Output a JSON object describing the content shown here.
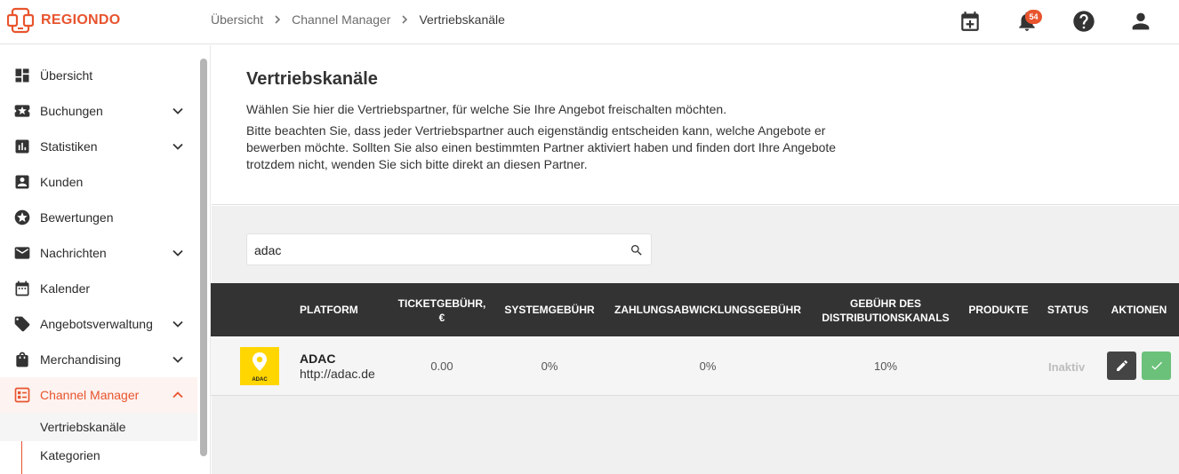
{
  "app": {
    "logo_text": "REGIONDO",
    "brand_color": "#e8542e"
  },
  "breadcrumb": [
    "Übersicht",
    "Channel Manager",
    "Vertriebskanäle"
  ],
  "topbar": {
    "notifications_count": "54",
    "icons": [
      "calendar-plus-icon",
      "bell-icon",
      "help-icon",
      "account-icon"
    ]
  },
  "sidebar": {
    "items": [
      {
        "label": "Übersicht",
        "icon": "dashboard-icon"
      },
      {
        "label": "Buchungen",
        "icon": "ticket-star-icon"
      },
      {
        "label": "Statistiken",
        "icon": "bar-chart-icon"
      },
      {
        "label": "Kunden",
        "icon": "account-box-icon"
      },
      {
        "label": "Bewertungen",
        "icon": "star-circle-icon"
      },
      {
        "label": "Nachrichten",
        "icon": "mail-icon"
      },
      {
        "label": "Kalender",
        "icon": "calendar-icon"
      },
      {
        "label": "Angebotsverwaltung",
        "icon": "tag-icon"
      },
      {
        "label": "Merchandising",
        "icon": "shopping-bag-icon"
      },
      {
        "label": "Channel Manager",
        "icon": "channel-manager-icon"
      }
    ],
    "sub_items": [
      "Vertriebskanäle",
      "Kategorien"
    ]
  },
  "page": {
    "title": "Vertriebskanäle",
    "intro": "Wählen Sie hier die Vertriebspartner, für welche Sie Ihre Angebot freischalten möchten.",
    "note": "Bitte beachten Sie, dass jeder Vertriebspartner auch eigenständig entscheiden kann, welche Angebote er bewerben möchte. Sollten Sie also einen bestimmten Partner aktiviert haben und finden dort Ihre Angebote trotzdem nicht, wenden Sie sich bitte direkt an diesen Partner."
  },
  "search": {
    "value": "adac",
    "placeholder": ""
  },
  "table": {
    "headers": {
      "platform": "PLATFORM",
      "ticket_fee_1": "TICKETGEBÜHR,",
      "ticket_fee_2": "€",
      "system_fee": "SYSTEMGEBÜHR",
      "payment_fee": "ZAHLUNGSABWICKLUNGSGEBÜHR",
      "channel_fee_1": "GEBÜHR DES",
      "channel_fee_2": "DISTRIBUTIONSKANALS",
      "products": "PRODUKTE",
      "status": "STATUS",
      "actions": "AKTIONEN"
    },
    "rows": [
      {
        "logo_text": "ADAC",
        "name": "ADAC",
        "url": "http://adac.de",
        "ticket_fee": "0.00",
        "system_fee": "0%",
        "payment_fee": "0%",
        "channel_fee": "10%",
        "products": "",
        "status": "Inaktiv"
      }
    ]
  },
  "colors": {
    "header_bg": "#333333",
    "accent": "#e8542e",
    "ok_button": "#6cc17a",
    "edit_button": "#444444",
    "adac_yellow": "#ffd600"
  }
}
